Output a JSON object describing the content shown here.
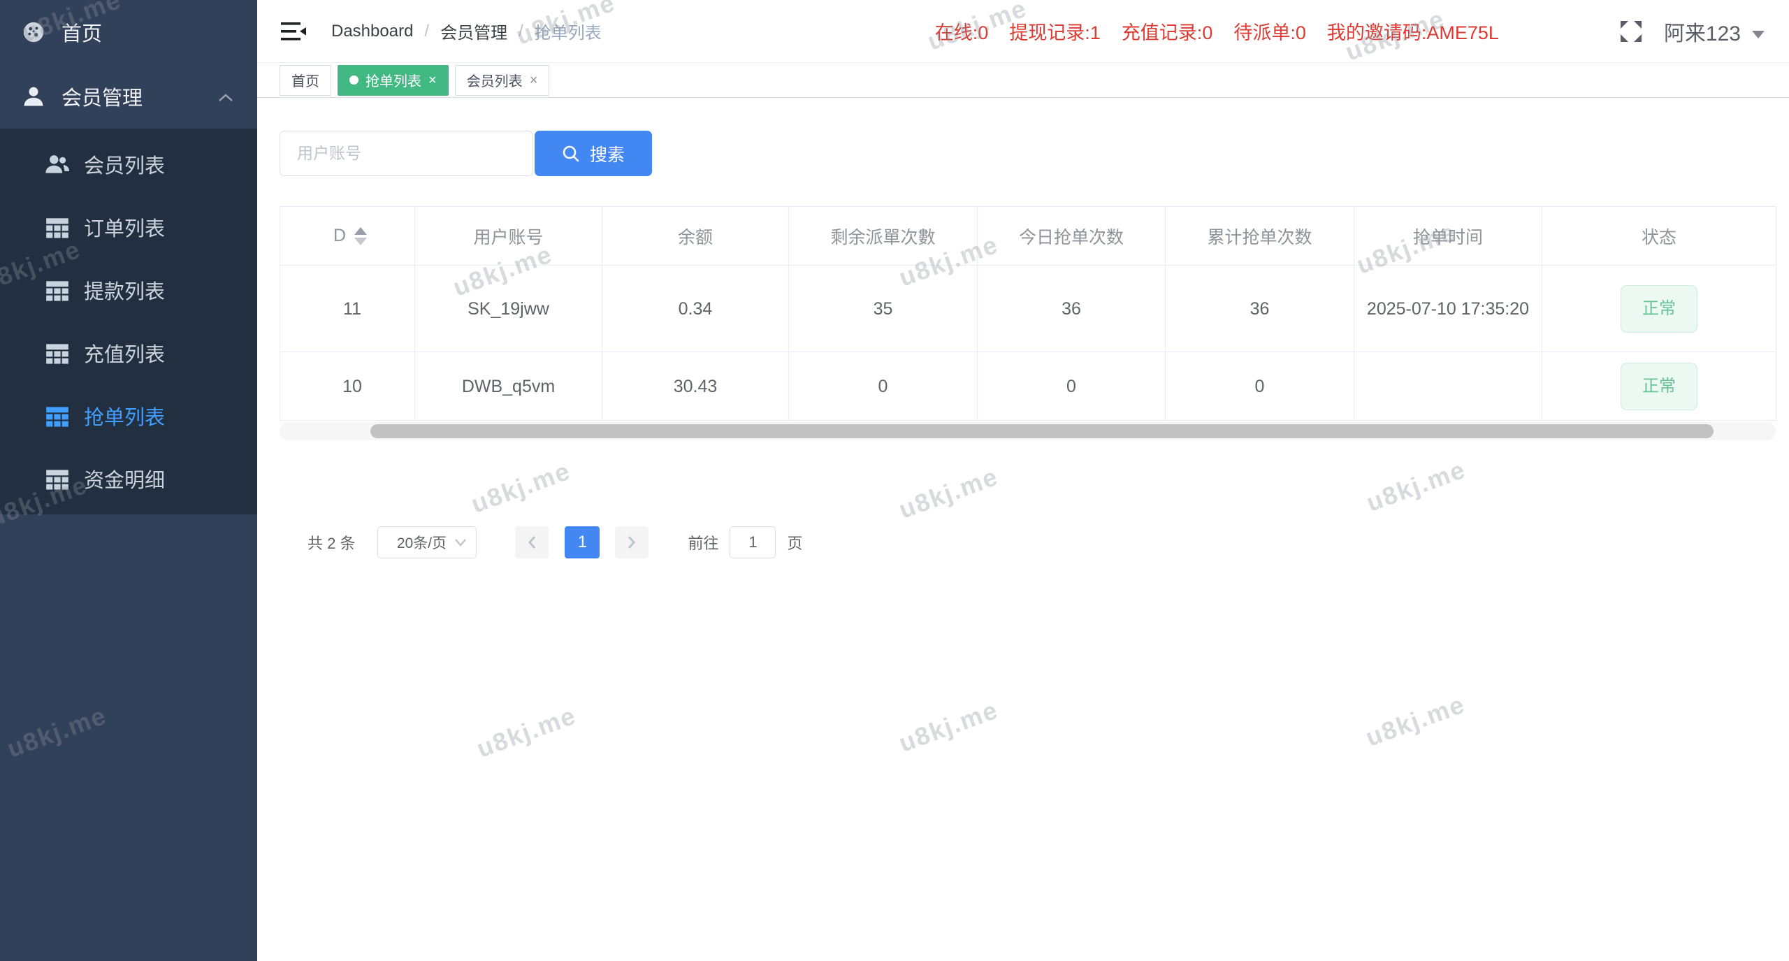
{
  "watermark": {
    "text": "u8kj.me"
  },
  "sidebar": {
    "items": [
      {
        "label": "首页",
        "icon": "dashboard-icon"
      },
      {
        "label": "会员管理",
        "icon": "user-icon",
        "expanded": true
      }
    ],
    "submenu": [
      {
        "label": "会员列表"
      },
      {
        "label": "订单列表"
      },
      {
        "label": "提款列表"
      },
      {
        "label": "充值列表"
      },
      {
        "label": "抢单列表",
        "active": true
      },
      {
        "label": "资金明细"
      }
    ]
  },
  "navbar": {
    "breadcrumb": {
      "0": "Dashboard",
      "1": "会员管理",
      "2": "抢单列表",
      "separator": "/"
    },
    "stats": {
      "0": "在线:0",
      "1": "提现记录:1",
      "2": "充值记录:0",
      "3": "待派单:0",
      "4": "我的邀请码:AME75L"
    },
    "username": "阿来123"
  },
  "tabs": {
    "0": {
      "label": "首页"
    },
    "1": {
      "label": "抢单列表",
      "active": true,
      "close": "×"
    },
    "2": {
      "label": "会员列表",
      "close": "×"
    }
  },
  "search": {
    "placeholder": "用户账号",
    "button_label": "搜素"
  },
  "table": {
    "columns": {
      "id": "D",
      "account": "用户账号",
      "balance": "余额",
      "remaining": "剩余派單次數",
      "today": "今日抢单次数",
      "total": "累计抢单次数",
      "time": "抢单时间",
      "status": "状态"
    },
    "rows": {
      "0": {
        "id": "11",
        "account": "SK_19jww",
        "balance": "0.34",
        "remaining": "35",
        "today": "36",
        "total": "36",
        "time": "2025-07-10 17:35:20",
        "status": "正常"
      },
      "1": {
        "id": "10",
        "account": "DWB_q5vm",
        "balance": "30.43",
        "remaining": "0",
        "today": "0",
        "total": "0",
        "time": "",
        "status": "正常"
      }
    }
  },
  "pagination": {
    "total": "共 2 条",
    "page_size": "20条/页",
    "current_page": "1",
    "goto_label": "前往",
    "goto_value": "1",
    "page_label": "页"
  },
  "colors": {
    "sidebar_bg": "#32415a",
    "submenu_bg": "#222f40",
    "accent_blue": "#4387f2",
    "menu_active_blue": "#409eff",
    "tab_active_green": "#42b983",
    "stats_red": "#dd3b33",
    "status_green_text": "#68c197",
    "status_green_bg": "#ecf9f2"
  }
}
